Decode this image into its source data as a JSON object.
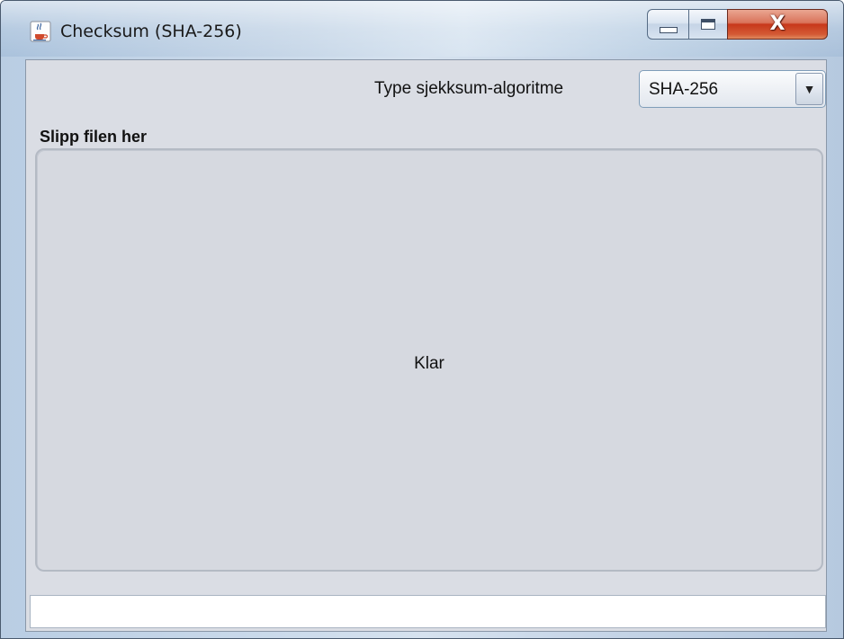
{
  "window": {
    "title": "Checksum (SHA-256)",
    "icon": "java-coffee-cup-icon",
    "controls": {
      "minimize_icon": "minimize-icon",
      "maximize_icon": "maximize-icon",
      "close_icon": "close-icon",
      "close_glyph": "X"
    }
  },
  "toolbar": {
    "algorithm_label": "Type sjekksum-algoritme",
    "algorithm_selected": "SHA-256",
    "dropdown_icon": "chevron-down-icon",
    "dropdown_glyph": "▼"
  },
  "drop_panel": {
    "title": "Slipp filen her",
    "status": "Klar"
  },
  "status_field": {
    "value": ""
  },
  "colors": {
    "content_background": "#dadde4",
    "drop_zone_background": "#d6d9e0",
    "close_button": "#c7381b"
  }
}
